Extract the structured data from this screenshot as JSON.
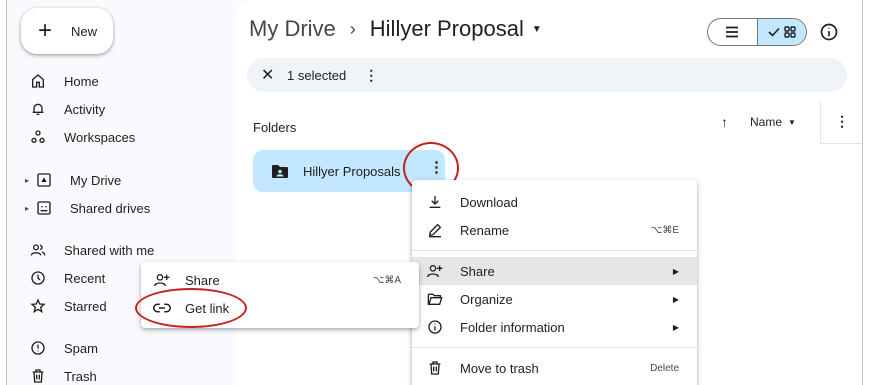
{
  "sidebar": {
    "new_label": "New",
    "items": [
      {
        "label": "Home",
        "icon": "home-icon"
      },
      {
        "label": "Activity",
        "icon": "bell-icon"
      },
      {
        "label": "Workspaces",
        "icon": "workspaces-icon"
      },
      {
        "label": "My Drive",
        "icon": "drive-icon"
      },
      {
        "label": "Shared drives",
        "icon": "shared-drives-icon"
      },
      {
        "label": "Shared with me",
        "icon": "people-icon"
      },
      {
        "label": "Recent",
        "icon": "clock-icon"
      },
      {
        "label": "Starred",
        "icon": "star-icon"
      },
      {
        "label": "Spam",
        "icon": "spam-icon"
      },
      {
        "label": "Trash",
        "icon": "trash-icon"
      }
    ]
  },
  "header": {
    "root": "My Drive",
    "separator": "›",
    "current": "Hillyer Proposal"
  },
  "selection_bar": {
    "count_text": "1 selected"
  },
  "content": {
    "section_label": "Folders",
    "sort_label": "Name",
    "folder_name": "Hillyer Proposals"
  },
  "context_menu": {
    "items": [
      {
        "label": "Download",
        "shortcut": ""
      },
      {
        "label": "Rename",
        "shortcut": "⌥⌘E"
      },
      {
        "label": "Share",
        "shortcut": ""
      },
      {
        "label": "Organize",
        "shortcut": ""
      },
      {
        "label": "Folder information",
        "shortcut": ""
      },
      {
        "label": "Move to trash",
        "shortcut": "Delete"
      }
    ]
  },
  "share_submenu": {
    "items": [
      {
        "label": "Share",
        "shortcut": "⌥⌘A"
      },
      {
        "label": "Get link",
        "shortcut": ""
      }
    ]
  },
  "colors": {
    "selection_blue": "#c2e7ff",
    "highlight_ring": "#c5221f",
    "background": "#f8fafd"
  }
}
